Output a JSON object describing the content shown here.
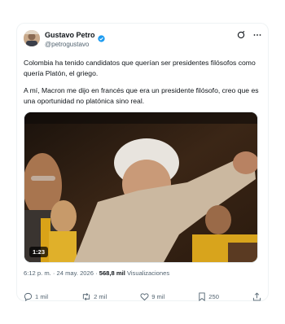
{
  "author": {
    "display_name": "Gustavo Petro",
    "handle": "@petrogustavo",
    "verified_color": "#1d9bf0"
  },
  "header_icons": [
    "grok-icon",
    "more-icon"
  ],
  "tweet": {
    "paragraphs": [
      "Colombia ha tenido candidatos que querían ser  presidentes filósofos como quería Platón, el griego.",
      "A mí, Macron me dijo en francés que era un presidente filósofo, creo que es una oportunidad no platónica sino real."
    ]
  },
  "media": {
    "duration": "1:23"
  },
  "meta": {
    "time": "6:12 p. m.",
    "separator": " · ",
    "date": "24 may. 2026",
    "views_count": "568,8 mil",
    "views_label": " Visualizaciones"
  },
  "actions": {
    "replies": "1 mil",
    "reposts": "2 mil",
    "likes": "9 mil",
    "bookmarks": "250"
  },
  "colors": {
    "text": "#0f1419",
    "secondary": "#536471",
    "accent": "#1d9bf0"
  }
}
